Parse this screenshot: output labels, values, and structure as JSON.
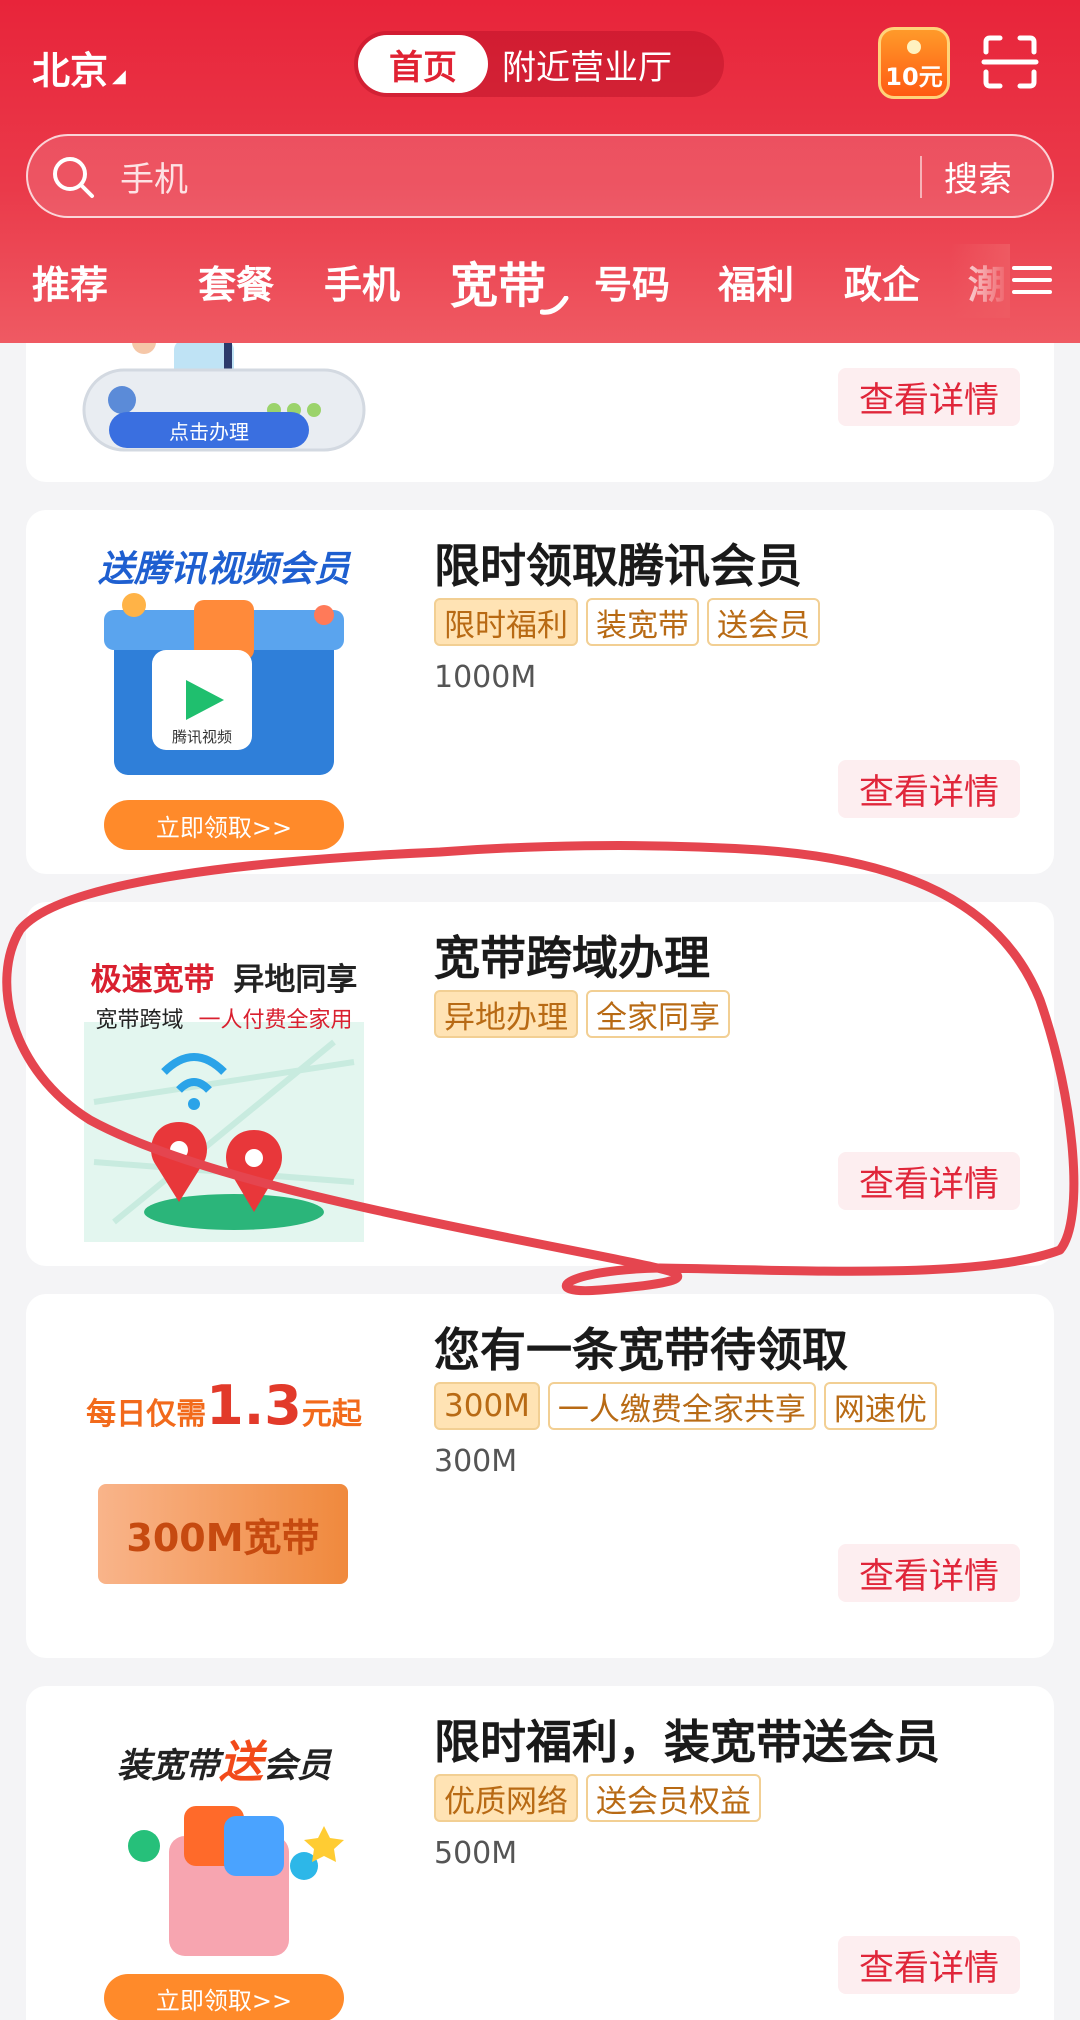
{
  "header": {
    "city": "北京",
    "segments": {
      "active": "首页",
      "other": "附近营业厅"
    },
    "coupon": {
      "label": "10元",
      "icon": "red-envelope-icon"
    },
    "scan_icon": "scan-icon"
  },
  "search": {
    "placeholder": "手机",
    "button": "搜索"
  },
  "tabs": [
    {
      "label": "推荐"
    },
    {
      "label": "套餐"
    },
    {
      "label": "手机"
    },
    {
      "label": "宽带",
      "active": true
    },
    {
      "label": "号码"
    },
    {
      "label": "福利"
    },
    {
      "label": "政企"
    },
    {
      "label": "潮"
    }
  ],
  "cards": [
    {
      "title": "",
      "image_text": {
        "button": "点击办理"
      },
      "detail": "查看详情"
    },
    {
      "title": "限时领取腾讯会员",
      "tags": [
        {
          "label": "限时福利",
          "filled": true
        },
        {
          "label": "装宽带"
        },
        {
          "label": "送会员"
        }
      ],
      "speed": "1000M",
      "image_text": {
        "headline": "送腾讯视频会员",
        "badge": "腾讯视频",
        "button": "立即领取>>"
      },
      "detail": "查看详情"
    },
    {
      "title": "宽带跨域办理",
      "tags": [
        {
          "label": "异地办理",
          "filled": true
        },
        {
          "label": "全家同享"
        }
      ],
      "image_text": {
        "line1_red": "极速宽带",
        "line1_black": "异地同享",
        "line2_black": "宽带跨域",
        "line2_red": "一人付费全家用"
      },
      "detail": "查看详情"
    },
    {
      "title": "您有一条宽带待领取",
      "tags": [
        {
          "label": "300M",
          "filled": true
        },
        {
          "label": "一人缴费全家共享"
        },
        {
          "label": "网速优"
        }
      ],
      "speed": "300M",
      "image_text": {
        "prefix": "每日仅需",
        "price": "1.3",
        "suffix": "元起",
        "box": "300M宽带"
      },
      "detail": "查看详情"
    },
    {
      "title": "限时福利，装宽带送会员",
      "tags": [
        {
          "label": "优质网络",
          "filled": true
        },
        {
          "label": "送会员权益"
        }
      ],
      "speed": "500M",
      "image_text": {
        "headline_a": "装宽带",
        "headline_b": "送",
        "headline_c": "会员",
        "button": "立即领取>>"
      },
      "detail": "查看详情"
    }
  ],
  "colors": {
    "brand_red": "#e8243a",
    "tag_border": "#f2cf93",
    "tag_text": "#b86a14",
    "annotation": "#e5454f"
  }
}
